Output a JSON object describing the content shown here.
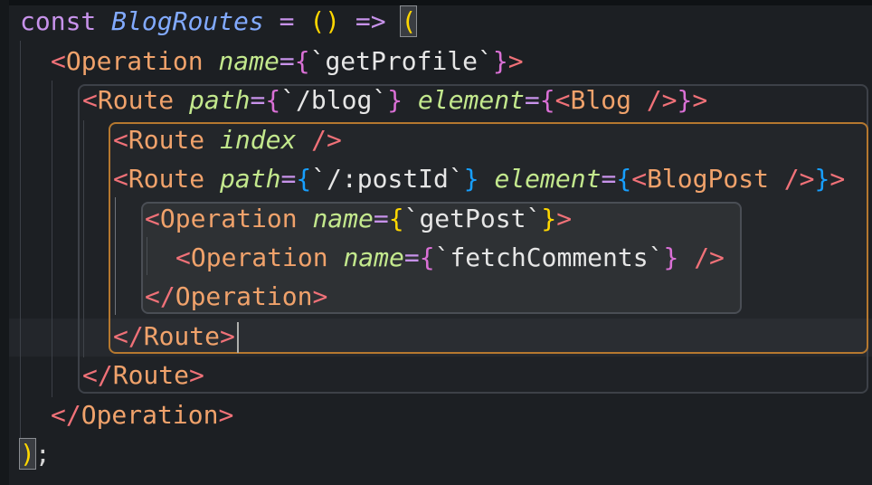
{
  "editor": {
    "lines": [
      {
        "id": "l1",
        "tokens": [
          "const",
          "BlogRoutes",
          "=",
          "()",
          "=>",
          "("
        ]
      },
      {
        "id": "l2",
        "text": "<Operation name={`getProfile`}>"
      },
      {
        "id": "l3",
        "text": "<Route path={`/blog`} element={<Blog />}>"
      },
      {
        "id": "l4",
        "text": "<Route index />"
      },
      {
        "id": "l5",
        "text": "<Route path={`/:postId`} element={<BlogPost />}>"
      },
      {
        "id": "l6",
        "text": "<Operation name={`getPost`}>"
      },
      {
        "id": "l7",
        "text": "<Operation name={`fetchComments`} />"
      },
      {
        "id": "l8",
        "text": "</Operation>"
      },
      {
        "id": "l9",
        "text": "</Route>"
      },
      {
        "id": "l10",
        "text": "</Route>"
      },
      {
        "id": "l11",
        "text": "</Operation>"
      },
      {
        "id": "l12",
        "text": ");"
      }
    ],
    "tokens": {
      "const": "const",
      "blog_routes": "BlogRoutes",
      "eq": "=",
      "parens": "()",
      "arrow": "=>",
      "open_paren": "(",
      "close_paren": ")",
      "semicolon": ";",
      "lt": "<",
      "lt_slash": "</",
      "gt": ">",
      "self_close": "/>",
      "operation": "Operation",
      "route": "Route",
      "blog": "Blog",
      "blog_post": "BlogPost",
      "name_attr": "name",
      "path_attr": "path",
      "element_attr": "element",
      "index_attr": "index",
      "lbrace": "{",
      "rbrace": "}",
      "backtick": "`",
      "get_profile": "getProfile",
      "blog_path": "/blog",
      "post_id_path": "/:postId",
      "get_post": "getPost",
      "fetch_comments": "fetchComments"
    }
  },
  "colors": {
    "keyword": "#c792ea",
    "function_name": "#82aaff",
    "tag_bracket": "#f07178",
    "tag_name": "#f0a26b",
    "attribute": "#c3e88d",
    "bracket_yellow": "#ffd700",
    "bracket_purple": "#da70d6",
    "bracket_blue": "#179fff",
    "highlight_box_outer": "#3d4148",
    "highlight_box_orange": "#b5782f",
    "highlight_box_inner": "#4a4e55"
  }
}
